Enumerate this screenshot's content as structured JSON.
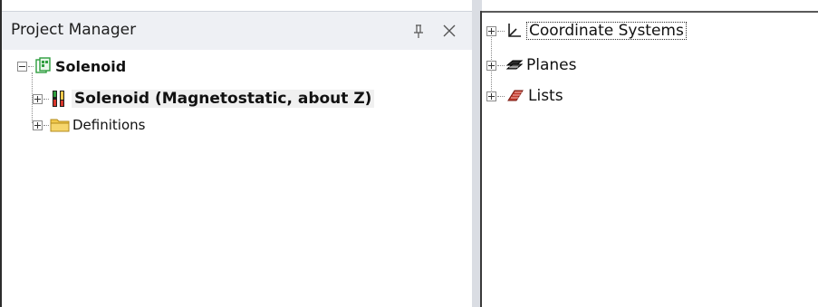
{
  "project_manager": {
    "title": "Project Manager",
    "pin_icon": "pin-icon",
    "close_icon": "close-icon",
    "tree": {
      "root": {
        "label": "Solenoid",
        "expanded": true,
        "icon": "project-icon"
      },
      "children": [
        {
          "label": "Solenoid (Magnetostatic, about Z)",
          "expanded": false,
          "icon": "model-icon",
          "bold": true
        },
        {
          "label": "Definitions",
          "expanded": false,
          "icon": "folder-icon",
          "bold": false
        }
      ]
    }
  },
  "object_tree": {
    "items": [
      {
        "label": "Coordinate Systems",
        "expanded": false,
        "icon": "coordinate-system-icon"
      },
      {
        "label": "Planes",
        "expanded": false,
        "icon": "planes-icon"
      },
      {
        "label": "Lists",
        "expanded": false,
        "icon": "lists-icon"
      }
    ]
  },
  "colors": {
    "header_bg": "#eef0f4",
    "splitter": "#dadde3",
    "folder": "#f2c94c",
    "project_green": "#2e9e3e",
    "model_red": "#d9362b",
    "lists_red": "#c0392b"
  }
}
